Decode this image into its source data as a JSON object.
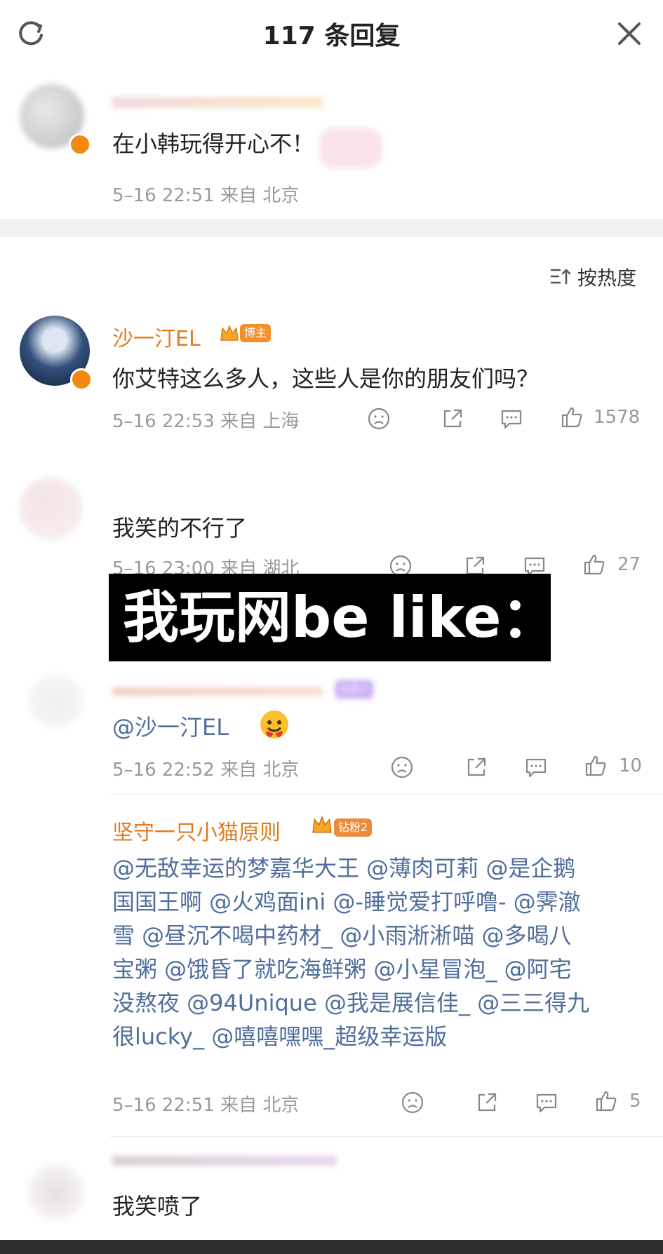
{
  "header": {
    "title": "117 条回复",
    "refresh_icon": "refresh-icon",
    "close_icon": "close-icon"
  },
  "root_comment": {
    "content": "在小韩玩得开心不！",
    "time": "5–16 22:51",
    "source": "来自 北京"
  },
  "sort": {
    "label": "按热度",
    "icon": "sort-icon"
  },
  "comments": [
    {
      "name": "沙一汀EL",
      "role_badge": "博主",
      "content": "你艾特这么多人，这些人是你的朋友们吗？",
      "time": "5–16 22:53",
      "source": "来自 上海",
      "likes": "1578"
    },
    {
      "content": "我笑的不行了",
      "time": "5–16 23:00",
      "source": "来自 湖北",
      "likes": "27"
    },
    {
      "fan_badge": "钻粉2",
      "content": "@沙一汀EL",
      "time": "5–16 22:52",
      "source": "来自 北京",
      "likes": "10"
    },
    {
      "name": "坚守一只小猫原则",
      "fan_badge": "钻粉2",
      "lines": [
        "@无敌幸运的梦嘉华大王 @薄肉可莉 @是企鹅",
        "国国王啊 @火鸡面ini @-睡觉爱打呼噜- @霁澈",
        "雪 @昼沉不喝中药材_ @小雨淅淅喵 @多喝八",
        "宝粥 @饿昏了就吃海鲜粥 @小星冒泡_ @阿宅",
        "没熬夜 @94Unique @我是展信佳_ @三三得九",
        "很lucky_ @嘻嘻嘿嘿_超级幸运版"
      ],
      "time": "5–16 22:51",
      "source": "来自 北京",
      "likes": "5"
    },
    {
      "content": "我笑喷了"
    }
  ],
  "overlay": {
    "text": "我玩网be like："
  },
  "colors": {
    "name": "#e27b1f",
    "mention": "#506e9b",
    "meta": "#999999",
    "verified": "#f08a11"
  }
}
